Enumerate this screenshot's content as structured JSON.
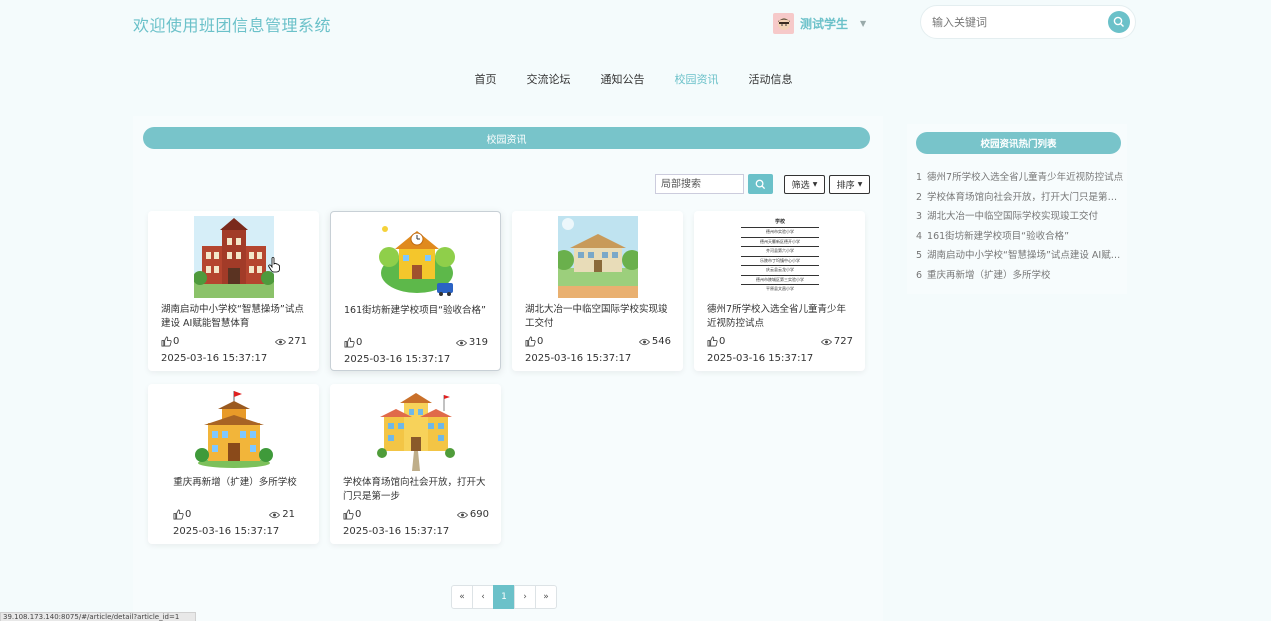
{
  "header": {
    "site_title": "欢迎使用班团信息管理系统",
    "user_name": "测试学生",
    "search_placeholder": "输入关键词"
  },
  "nav": {
    "items": [
      "首页",
      "交流论坛",
      "通知公告",
      "校园资讯",
      "活动信息"
    ],
    "active": "校园资讯"
  },
  "main": {
    "section_title": "校园资讯",
    "local_search_placeholder": "局部搜索",
    "filter_label": "筛选",
    "sort_label": "排序"
  },
  "cards": [
    {
      "title": "湖南启动中小学校“智慧操场”试点建设 AI赋能智慧体育",
      "likes": "0",
      "views": "271",
      "date": "2025-03-16 15:37:17",
      "image": "red-school-building"
    },
    {
      "title": "161街坊新建学校项目“验收合格”",
      "likes": "0",
      "views": "319",
      "date": "2025-03-16 15:37:17",
      "image": "cartoon-school-clock"
    },
    {
      "title": "湖北大冶一中临空国际学校实现竣工交付",
      "likes": "0",
      "views": "546",
      "date": "2025-03-16 15:37:17",
      "image": "painted-school-scene"
    },
    {
      "title": "德州7所学校入选全省儿童青少年近视防控试点",
      "likes": "0",
      "views": "727",
      "date": "2025-03-16 15:37:17",
      "image": "school-list-table"
    },
    {
      "title": "重庆再新增（扩建）多所学校",
      "likes": "0",
      "views": "21",
      "date": "2025-03-16 15:37:17",
      "image": "school-with-flag"
    },
    {
      "title": "学校体育场馆向社会开放，打开大门只是第一步",
      "likes": "0",
      "views": "690",
      "date": "2025-03-16 15:37:17",
      "image": "yellow-school-building"
    }
  ],
  "school_table": {
    "header": "学校",
    "rows": [
      "德州市实验小学",
      "德州天衢新区德开小学",
      "齐河县第六小学",
      "乐陵市丁坞镇中心小学",
      "庆云县云龙小学",
      "德州市陵城区第三实验小学",
      "平原县文昌小学"
    ]
  },
  "side": {
    "title": "校园资讯热门列表",
    "items": [
      "德州7所学校入选全省儿童青少年近视防控试点",
      "学校体育场馆向社会开放，打开大门只是第一步",
      "湖北大冶一中临空国际学校实现竣工交付",
      "161街坊新建学校项目“验收合格”",
      "湖南启动中小学校“智慧操场”试点建设 AI赋能智慧体育",
      "重庆再新增（扩建）多所学校"
    ],
    "numbers": [
      "1",
      "2",
      "3",
      "4",
      "5",
      "6"
    ]
  },
  "pagination": {
    "first": "«",
    "prev": "‹",
    "current": "1",
    "next": "›",
    "last": "»"
  },
  "status_url": "39.108.173.140:8075/#/article/detail?article_id=1",
  "colors": {
    "accent": "#6bc1c9",
    "bar": "#78c4ca",
    "background": "#f4fbfc"
  }
}
